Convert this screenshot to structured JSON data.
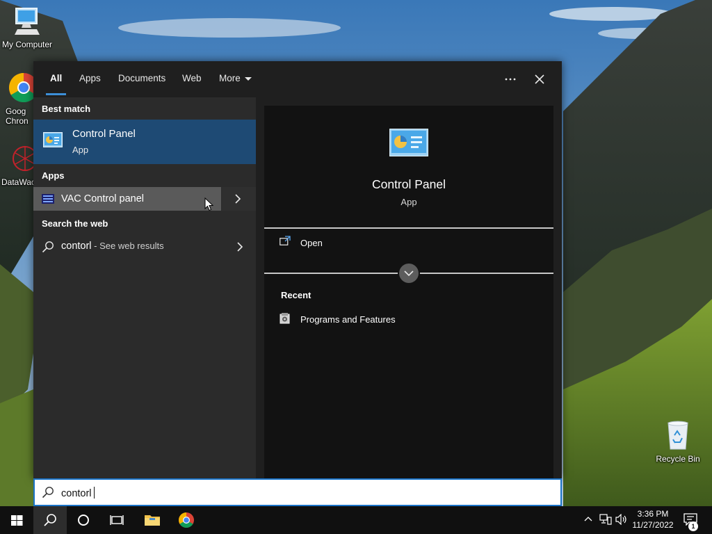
{
  "desktop": {
    "icons": [
      {
        "label": "My Computer"
      },
      {
        "label": "Goog Chron"
      },
      {
        "label": "DataWac"
      },
      {
        "label": "Recycle Bin"
      }
    ]
  },
  "search_panel": {
    "tabs": [
      {
        "label": "All"
      },
      {
        "label": "Apps"
      },
      {
        "label": "Documents"
      },
      {
        "label": "Web"
      },
      {
        "label": "More"
      }
    ],
    "results": {
      "best_match_header": "Best match",
      "best_match": {
        "name": "Control Panel",
        "type": "App"
      },
      "apps_header": "Apps",
      "apps": [
        {
          "name": "VAC Control panel"
        }
      ],
      "web_header": "Search the web",
      "web": {
        "query": "contorl",
        "suffix": " - See web results"
      }
    },
    "preview": {
      "title": "Control Panel",
      "subtitle": "App",
      "actions": [
        {
          "label": "Open"
        }
      ],
      "recent_header": "Recent",
      "recent": [
        {
          "label": "Programs and Features"
        }
      ]
    },
    "search_box": {
      "value": "contorl"
    }
  },
  "taskbar": {
    "time": "3:36 PM",
    "date": "11/27/2022",
    "notification_count": "1"
  },
  "colors": {
    "accent": "#3c8fd8",
    "best_match_bg": "#1e4a74",
    "hover_bg": "#5a5a5a",
    "panel_bg": "#1f1f1f"
  }
}
